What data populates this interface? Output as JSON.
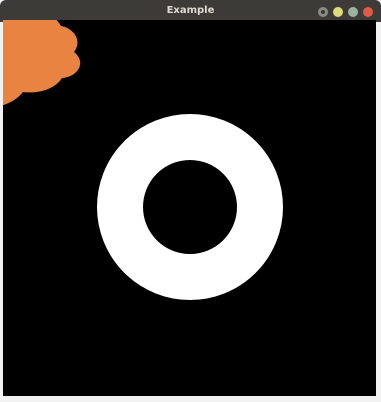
{
  "window": {
    "title": "Example"
  },
  "colors": {
    "titlebar": "#3c3b37",
    "canvas_background": "#000000",
    "ring": "#ffffff",
    "blob": "#e98342"
  },
  "icons": {
    "help": "help-icon",
    "minimize": "minimize-icon",
    "maximize": "maximize-icon",
    "close": "close-icon"
  }
}
